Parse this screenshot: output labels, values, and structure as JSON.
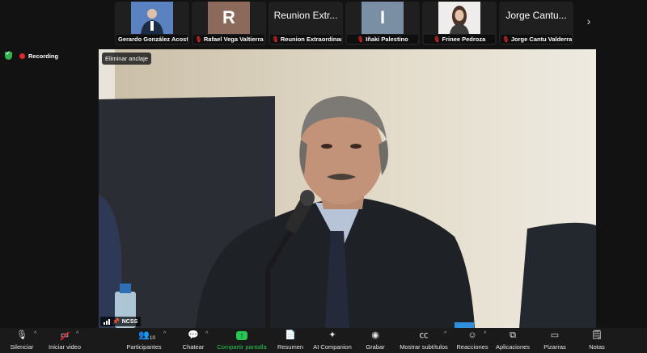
{
  "participants": [
    {
      "name": "Gerardo González Acosta",
      "thumb": "",
      "muted": false,
      "bg": "#4a6fa5"
    },
    {
      "name": "Rafael Vega Valtierra",
      "thumb": "R",
      "muted": true,
      "bg": "#8b6a5c"
    },
    {
      "name": "Reunion Extraordinaria",
      "thumb": "Reunion Extr...",
      "muted": true,
      "bg": "#1f1f1f"
    },
    {
      "name": "Iñaki Palestino",
      "thumb": "I",
      "muted": true,
      "bg": "#7a8fa3"
    },
    {
      "name": "Frinee Pedroza",
      "thumb": "",
      "muted": true,
      "bg": "#e8e6e4"
    },
    {
      "name": "Jorge Cantu Valderra...",
      "thumb": "Jorge Cantu...",
      "muted": true,
      "bg": "#1f1f1f"
    }
  ],
  "recording_label": "Recording",
  "main_video": {
    "unpin_label": "Eliminar anclaje",
    "speaker_name": "NCSS"
  },
  "toolbar": {
    "mute": "Silenciar",
    "video": "Iniciar video",
    "participants": "Participantes",
    "participant_count": "10",
    "chat": "Chatear",
    "share": "Compartir pantalla",
    "summary": "Resumen",
    "companion": "AI Companion",
    "record": "Grabar",
    "captions": "Mostrar subtítulos",
    "reactions": "Reacciones",
    "apps": "Aplicaciones",
    "whiteboards": "Pizarras",
    "notes": "Notas"
  },
  "colors": {
    "accent_green": "#29c553",
    "muted_red": "#e02828",
    "recording_red": "#e02828"
  }
}
